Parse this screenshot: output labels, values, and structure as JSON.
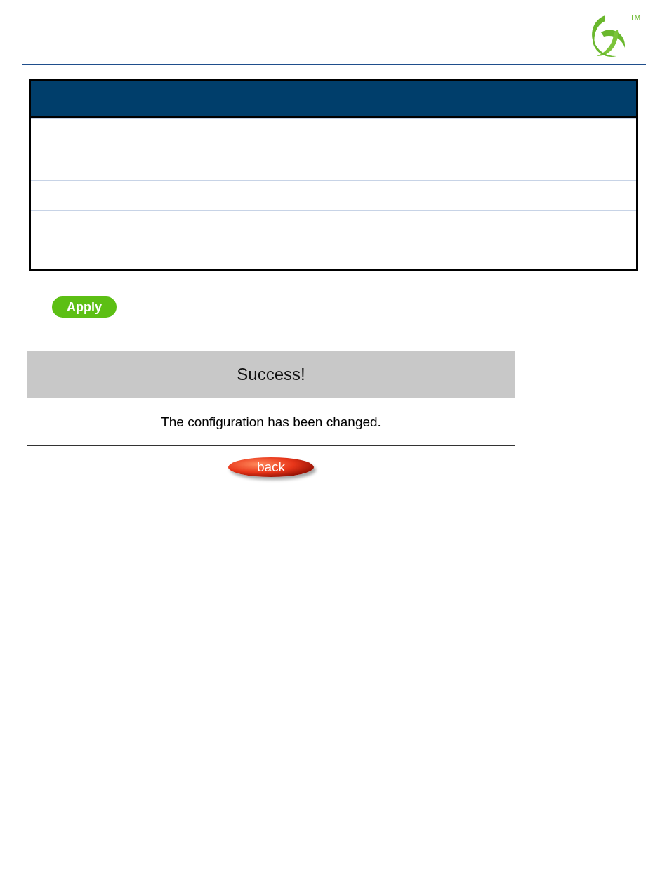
{
  "logo": {
    "mark": "TM"
  },
  "apply_button": "Apply",
  "dialog": {
    "title": "Success!",
    "message": "The configuration has been changed.",
    "back_button": "back"
  }
}
